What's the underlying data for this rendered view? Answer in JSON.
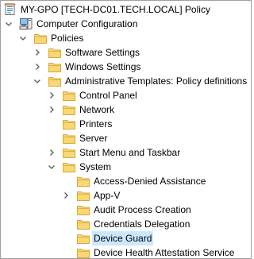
{
  "tree": [
    {
      "label": "MY-GPO [TECH-DC01.TECH.LOCAL] Policy",
      "icon": "gpo-scroll-icon",
      "twisty": "none",
      "level": 0
    },
    {
      "label": "Computer Configuration",
      "icon": "computer-icon",
      "twisty": "expanded",
      "level": 0
    },
    {
      "label": "Policies",
      "icon": "folder-icon",
      "twisty": "expanded",
      "level": 1
    },
    {
      "label": "Software Settings",
      "icon": "folder-icon",
      "twisty": "collapsed",
      "level": 2
    },
    {
      "label": "Windows Settings",
      "icon": "folder-icon",
      "twisty": "collapsed",
      "level": 2
    },
    {
      "label": "Administrative Templates: Policy definitions",
      "icon": "folder-icon",
      "twisty": "expanded",
      "level": 2
    },
    {
      "label": "Control Panel",
      "icon": "folder-icon",
      "twisty": "collapsed",
      "level": 3
    },
    {
      "label": "Network",
      "icon": "folder-icon",
      "twisty": "collapsed",
      "level": 3
    },
    {
      "label": "Printers",
      "icon": "folder-icon",
      "twisty": "none",
      "level": 3
    },
    {
      "label": "Server",
      "icon": "folder-icon",
      "twisty": "none",
      "level": 3
    },
    {
      "label": "Start Menu and Taskbar",
      "icon": "folder-icon",
      "twisty": "collapsed",
      "level": 3
    },
    {
      "label": "System",
      "icon": "folder-icon",
      "twisty": "expanded",
      "level": 3
    },
    {
      "label": "Access-Denied Assistance",
      "icon": "folder-icon",
      "twisty": "none",
      "level": 4
    },
    {
      "label": "App-V",
      "icon": "folder-icon",
      "twisty": "collapsed",
      "level": 4
    },
    {
      "label": "Audit Process Creation",
      "icon": "folder-icon",
      "twisty": "none",
      "level": 4
    },
    {
      "label": "Credentials Delegation",
      "icon": "folder-icon",
      "twisty": "none",
      "level": 4
    },
    {
      "label": "Device Guard",
      "icon": "folder-icon",
      "twisty": "none",
      "level": 4,
      "selected": true
    },
    {
      "label": "Device Health Attestation Service",
      "icon": "folder-icon",
      "twisty": "none",
      "level": 4
    }
  ],
  "colors": {
    "folder_fill": "#f8d775",
    "folder_edge": "#d9a93a",
    "selection": "#cce8ff",
    "twisty": "#5a5a5a",
    "border": "#a0a0a0"
  }
}
